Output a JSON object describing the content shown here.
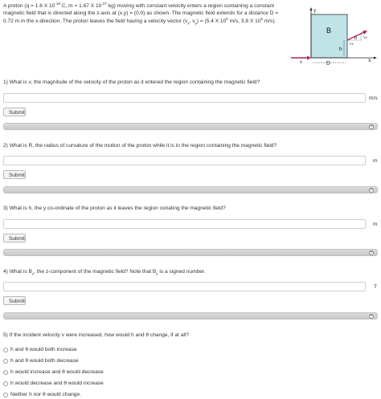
{
  "intro": {
    "line1": "A proton (q = 1.6 X 10",
    "line1_exp1": "-19",
    "line1_mid": " C, m = 1.67 X 10",
    "line1_exp2": "-27",
    "line1_end": " kg) moving with constant velocity enters a region containing a constant",
    "line2": "magnetic field that is directed along the z-axis at (x,y) = (0,0) as shown. The magnetic field extends for a distance D =",
    "line3a": "0.72 m in the x-direction. The proton leaves the field having a velocity vector (v",
    "line3_sub1": "x",
    "line3b": ", v",
    "line3_sub2": "y",
    "line3c": ") = (5.4 X 10",
    "line3_exp1": "5",
    "line3d": " m/s, 3.8 X 10",
    "line3_exp2": "5",
    "line3e": " m/s)."
  },
  "diagram": {
    "field_label": "B",
    "y_axis_label": "y",
    "x_axis_label": "x",
    "v_label": "v",
    "d_label": "D",
    "h_label": "h",
    "theta_label": "θ",
    "vx_label": "vx",
    "vy_label": "vy",
    "field_color": "#bfe3e6",
    "arrow_color": "#b0245a"
  },
  "questions": [
    {
      "text": "1) What is v, the magnitude of the velocity of the proton as it entered the region containing the magnetic field?",
      "unit": "m/s",
      "submit": "Submit"
    },
    {
      "text": "2) What is R, the radius of curvature of the motion of the proton while it is in the region containing the magnetic field?",
      "unit": "m",
      "submit": "Submit"
    },
    {
      "text": "3) What is h, the y co-ordinate of the proton as it leaves the region conating the magnetic field?",
      "unit": "m",
      "submit": "Submit"
    },
    {
      "text_a": "4) What is B",
      "text_sub": "z",
      "text_b": ", the z-component of the magnetic field? Note that B",
      "text_sub2": "z",
      "text_c": " is a signed number.",
      "unit": "T",
      "submit": "Submit"
    }
  ],
  "q5": {
    "text": "5) If the incident velocity v were increased, how would h and θ change, if at all?",
    "options": [
      "h and θ would both increase",
      "h and θ would both decrease",
      "h would increase and θ would decrease",
      "h would decrease and θ would increase",
      "Neither h nor θ would change."
    ]
  },
  "feedback_icon": "plus-circle-icon"
}
